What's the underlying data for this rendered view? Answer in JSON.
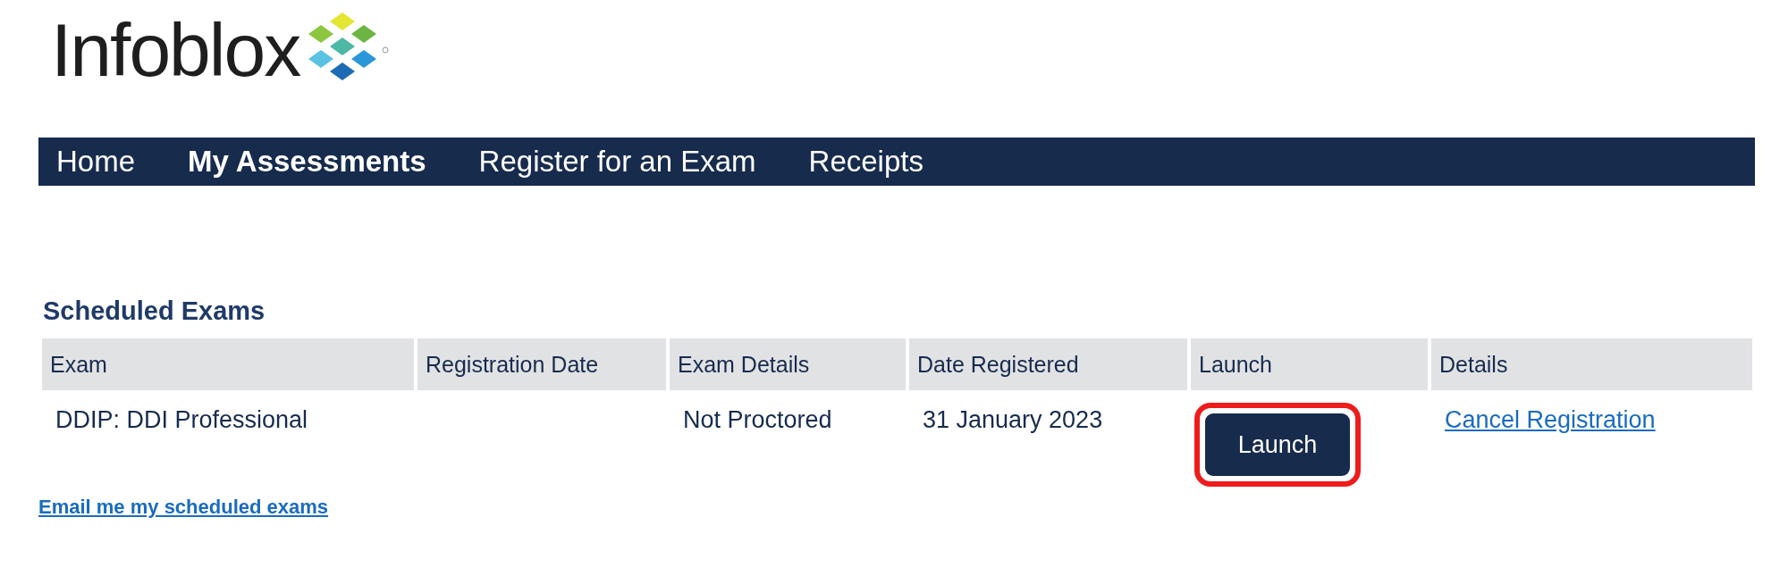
{
  "logo": {
    "text": "Infoblox"
  },
  "nav": [
    {
      "label": "Home",
      "selected": false
    },
    {
      "label": "My Assessments",
      "selected": true
    },
    {
      "label": "Register for an Exam",
      "selected": false
    },
    {
      "label": "Receipts",
      "selected": false
    }
  ],
  "section_title": "Scheduled Exams",
  "table": {
    "columns": [
      "Exam",
      "Registration Date",
      "Exam Details",
      "Date Registered",
      "Launch",
      "Details"
    ],
    "rows": [
      {
        "exam": "DDIP: DDI Professional",
        "registration_date": "",
        "exam_details": "Not Proctored",
        "date_registered": "31 January 2023",
        "launch": {
          "label": "Launch",
          "highlighted": true
        },
        "details_link": "Cancel Registration"
      }
    ]
  },
  "email_link": "Email me my scheduled exams"
}
